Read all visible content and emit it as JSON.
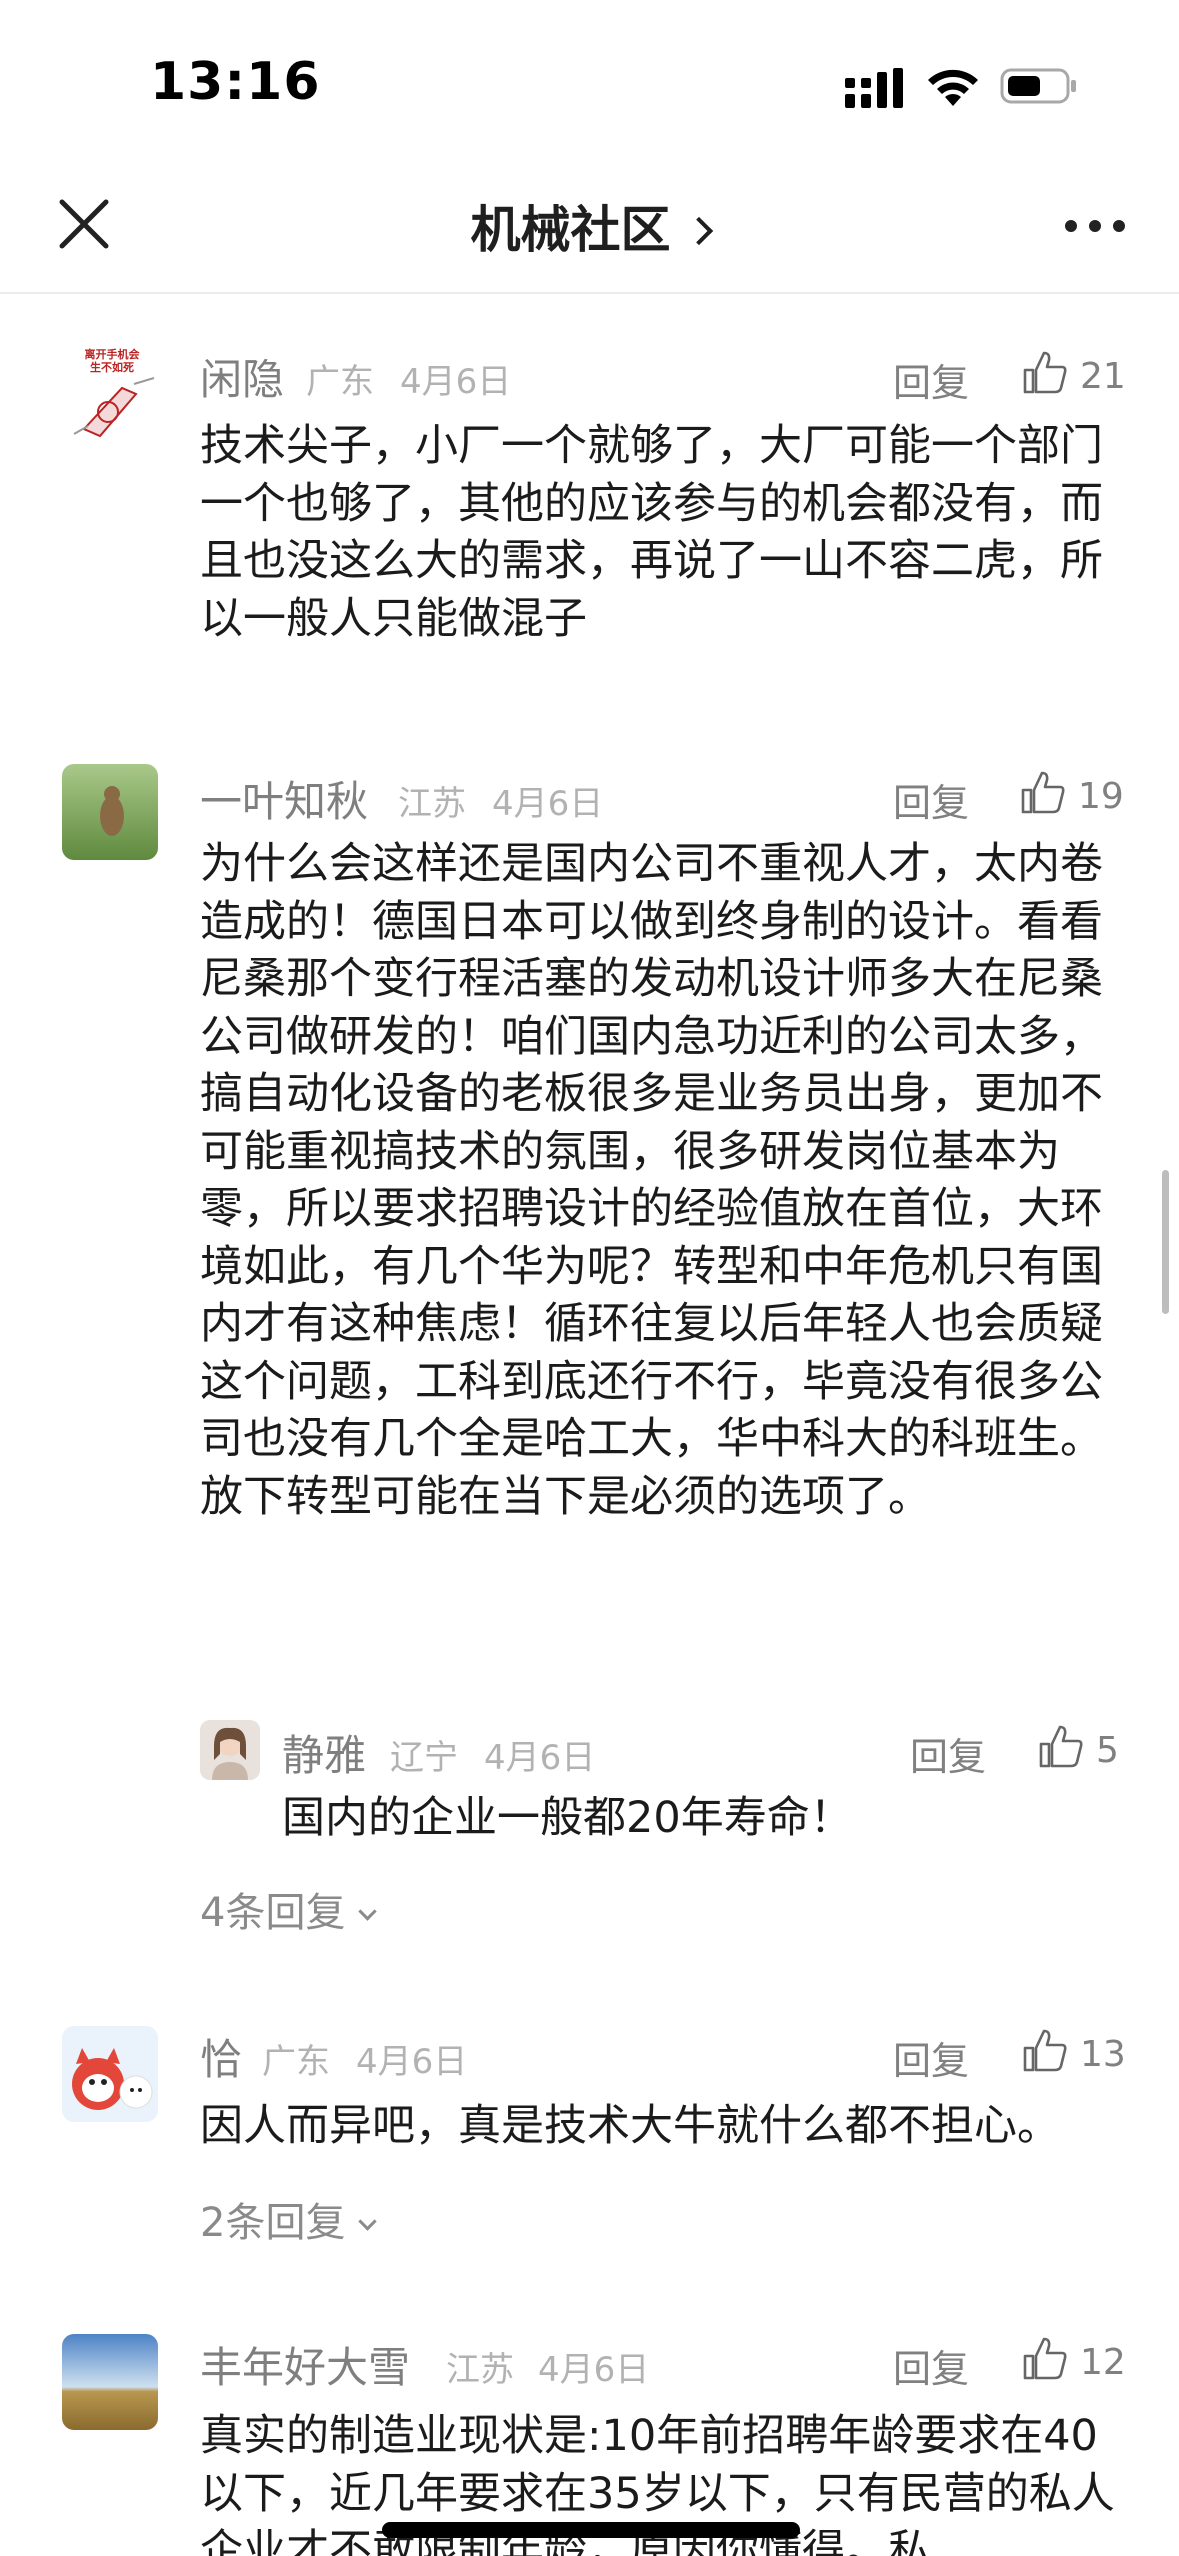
{
  "status_bar": {
    "time": "13:16"
  },
  "nav": {
    "title": "机械社区"
  },
  "comments": [
    {
      "user": "闲隐",
      "location": "广东",
      "date": "4月6日",
      "reply_label": "回复",
      "likes": "21",
      "avatar_text": [
        "离开手机会",
        "生不如死"
      ],
      "body": "技术尖子，小厂一个就够了，大厂可能一个部门一个也够了，其他的应该参与的机会都没有，而且也没这么大的需求，再说了一山不容二虎，所以一般人只能做混子"
    },
    {
      "user": "一叶知秋",
      "location": "江苏",
      "date": "4月6日",
      "reply_label": "回复",
      "likes": "19",
      "body": "为什么会这样还是国内公司不重视人才，太内卷造成的！德国日本可以做到终身制的设计。看看尼桑那个变行程活塞的发动机设计师多大在尼桑公司做研发的！咱们国内急功近利的公司太多，搞自动化设备的老板很多是业务员出身，更加不可能重视搞技术的氛围，很多研发岗位基本为零，所以要求招聘设计的经验值放在首位，大环境如此，有几个华为呢？转型和中年危机只有国内才有这种焦虑！循环往复以后年轻人也会质疑这个问题，工科到底还行不行，毕竟没有很多公司也没有几个全是哈工大，华中科大的科班生。放下转型可能在当下是必须的选项了。",
      "sub_reply": {
        "user": "静雅",
        "location": "辽宁",
        "date": "4月6日",
        "reply_label": "回复",
        "likes": "5",
        "body": "国内的企业一般都20年寿命！"
      },
      "more_replies": "4条回复"
    },
    {
      "user": "恰",
      "location": "广东",
      "date": "4月6日",
      "reply_label": "回复",
      "likes": "13",
      "body": "因人而异吧，真是技术大牛就什么都不担心。",
      "more_replies": "2条回复"
    },
    {
      "user": "丰年好大雪",
      "location": "江苏",
      "date": "4月6日",
      "reply_label": "回复",
      "likes": "12",
      "body": "真实的制造业现状是:10年前招聘年龄要求在40以下，近几年要求在35岁以下，只有民营的私人企业才不敢限制年龄，原因你懂得。私"
    }
  ],
  "colors": {
    "username": "#7f7f7f",
    "meta": "#b2b2b2",
    "body": "#1b1b1b"
  }
}
